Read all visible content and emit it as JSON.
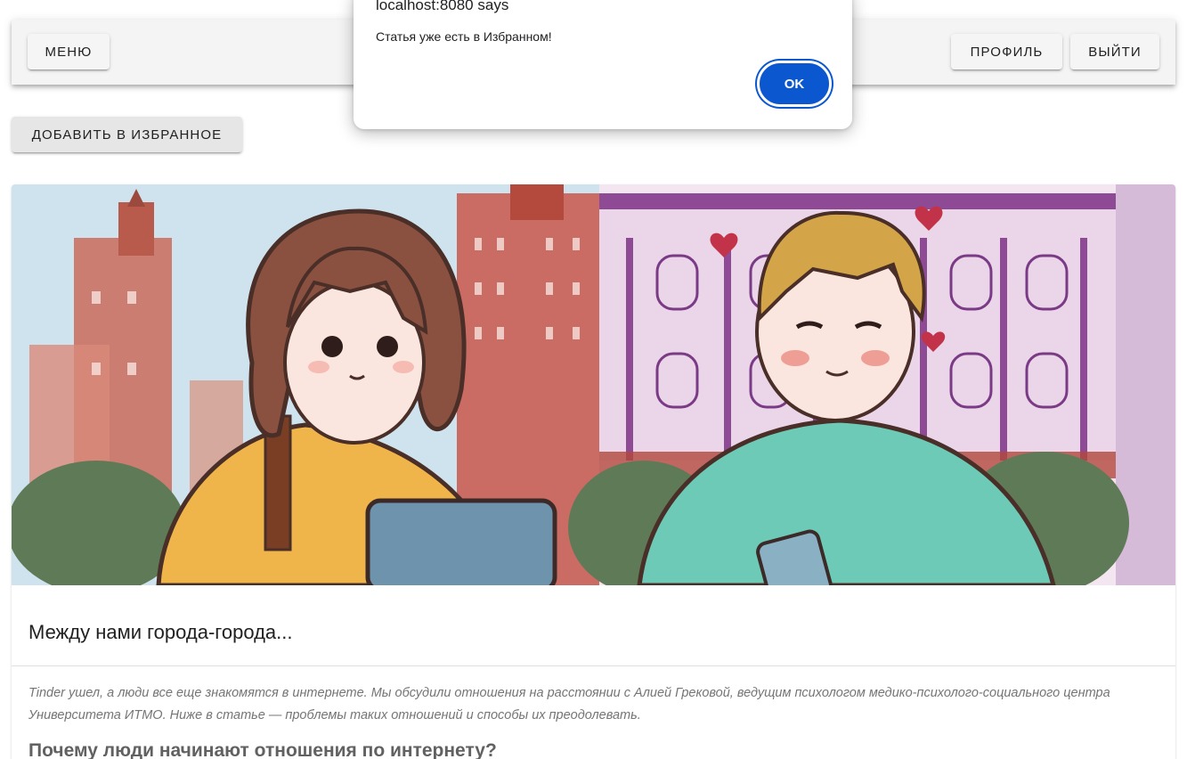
{
  "toolbar": {
    "menu_label": "Меню",
    "profile_label": "Профиль",
    "logout_label": "Выйти"
  },
  "actions": {
    "add_favorite_label": "Добавить в избранное"
  },
  "article": {
    "title": "Между нами города-города...",
    "lead": "Tinder ушел, а люди все еще знакомятся в интернете. Мы обсудили отношения на расстоянии с Алией Грековой, ведущим психологом медико-психолого-социального центра Университета ИТМО. Ниже в статье — проблемы таких отношений и способы их преодолевать.",
    "subheading": "Почему люди начинают отношения по интернету?"
  },
  "dialog": {
    "title": "localhost:8080 says",
    "message": "Статья уже есть в Избранном!",
    "ok_label": "OK"
  },
  "colors": {
    "appbar_bg": "#f4f4f4",
    "dialog_button": "#0b57d0",
    "lead_text": "#757575"
  }
}
